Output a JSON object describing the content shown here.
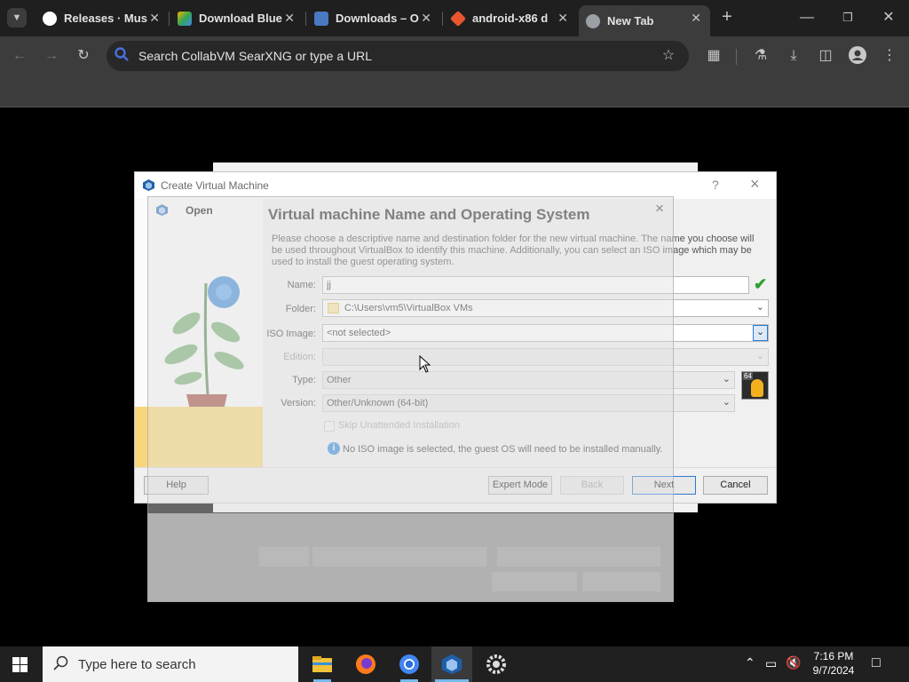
{
  "browser": {
    "tabs": [
      {
        "title": "Releases · Mus",
        "color": "#ffffff"
      },
      {
        "title": "Download Blue",
        "color": "#f4b400"
      },
      {
        "title": "Downloads – O",
        "color": "#4a78c2"
      },
      {
        "title": "android-x86 d",
        "color": "#e8562e"
      },
      {
        "title": "New Tab",
        "color": "#9aa0a6"
      }
    ],
    "new_tab_label": "+",
    "address_placeholder": "Search CollabVM SearXNG or type a URL"
  },
  "vbox": {
    "title": "Create Virtual Machine",
    "help_label": "?",
    "close_label": "×",
    "heading": "Virtual machine Name and Operating System",
    "description": "Please choose a descriptive name and destination folder for the new virtual machine. The name you choose will be used throughout VirtualBox to identify this machine. Additionally, you can select an ISO image which may be used to install the guest operating system.",
    "fields": {
      "name_label": "Name:",
      "name_value": "jj",
      "folder_label": "Folder:",
      "folder_value": "C:\\Users\\vm5\\VirtualBox VMs",
      "iso_label": "ISO Image:",
      "iso_value": "<not selected>",
      "edition_label": "Edition:",
      "edition_value": "",
      "type_label": "Type:",
      "type_value": "Other",
      "version_label": "Version:",
      "version_value": "Other/Unknown (64-bit)"
    },
    "os_badge": "64",
    "skip_unattended": "Skip Unattended Installation",
    "info_text": "No ISO image is selected, the guest OS will need to be installed manually.",
    "buttons": {
      "help": "Help",
      "expert": "Expert Mode",
      "back": "Back",
      "next": "Next",
      "cancel": "Cancel"
    }
  },
  "open_dialog": {
    "title": "Open",
    "close_label": "×"
  },
  "taskbar": {
    "search_placeholder": "Type here to search",
    "time": "7:16 PM",
    "date": "9/7/2024"
  }
}
